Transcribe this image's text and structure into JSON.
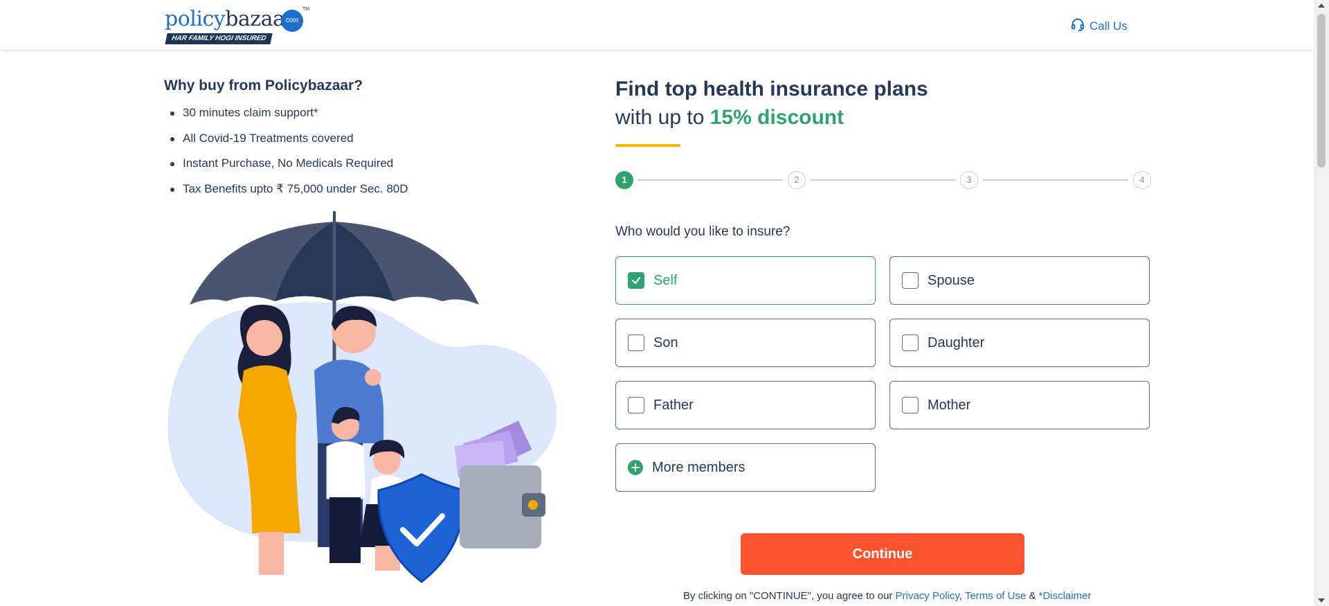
{
  "header": {
    "logo": {
      "word1": "policy",
      "word2": "bazaar",
      "dot": "com",
      "tm": "TM",
      "tagline": "HAR FAMILY HOGI INSURED"
    },
    "call_label": "Call Us",
    "call_icon": "headset-icon"
  },
  "why": {
    "title": "Why buy from Policybazaar?",
    "points": [
      "30 minutes claim support*",
      "All Covid-19 Treatments covered",
      "Instant Purchase, No Medicals Required",
      "Tax Benefits upto ₹ 75,000 under Sec. 80D"
    ]
  },
  "form": {
    "heading_line1": "Find top health insurance plans",
    "heading_line2_prefix": "with up to ",
    "heading_discount": "15% discount",
    "steps": [
      "1",
      "2",
      "3",
      "4"
    ],
    "active_step": 1,
    "question": "Who would you like to insure?",
    "options": [
      {
        "label": "Self",
        "checked": true
      },
      {
        "label": "Spouse",
        "checked": false
      },
      {
        "label": "Son",
        "checked": false
      },
      {
        "label": "Daughter",
        "checked": false
      },
      {
        "label": "Father",
        "checked": false
      },
      {
        "label": "Mother",
        "checked": false
      }
    ],
    "more_members": "More members",
    "continue_label": "Continue",
    "terms_prefix": "By clicking on \"CONTINUE\", you agree to our ",
    "privacy": "Privacy Policy",
    "comma": ", ",
    "terms_of_use": "Terms of Use",
    "amp": " & ",
    "disclaimer": "*Disclaimer"
  },
  "colors": {
    "brand_blue": "#1d6fce",
    "navy": "#253858",
    "green": "#2ea36d",
    "orange": "#fa532e",
    "yellow": "#f7b500"
  }
}
